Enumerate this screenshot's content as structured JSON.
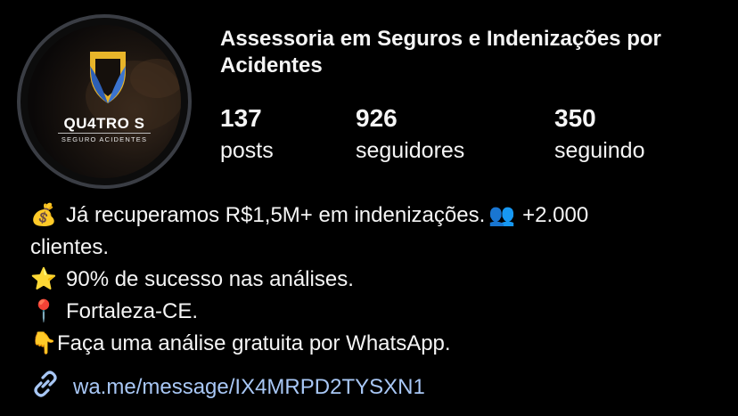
{
  "profile": {
    "name": "Assessoria em Seguros e Indenizações por Acidentes",
    "avatar": {
      "brand": "QU4TRO S",
      "tagline": "SEGURO ACIDENTES"
    }
  },
  "stats": [
    {
      "count": "137",
      "label": "posts"
    },
    {
      "count": "926",
      "label": "seguidores"
    },
    {
      "count": "350",
      "label": "seguindo"
    }
  ],
  "bio": {
    "line1_emoji": "💰",
    "line1_text": "Já recuperamos R$1,5M+ em indenizações.",
    "line1_emoji2": "👥",
    "line1_text2": "+2.000",
    "line2_text": "clientes.",
    "line3_emoji": "⭐",
    "line3_text": "90% de sucesso nas análises.",
    "line4_emoji": "📍",
    "line4_text": "Fortaleza-CE.",
    "line5_emoji": "👇",
    "line5_text": "Faça uma análise gratuita por WhatsApp."
  },
  "link": {
    "icon": "link-icon",
    "text": "wa.me/message/IX4MRPD2TYSXN1"
  },
  "colors": {
    "background": "#000000",
    "text": "#f5f5f5",
    "link": "#a8c7f5",
    "avatar_ring": "#3a3d44",
    "shield_gold": "#e8b52a",
    "shield_blue": "#2d5fb5"
  }
}
